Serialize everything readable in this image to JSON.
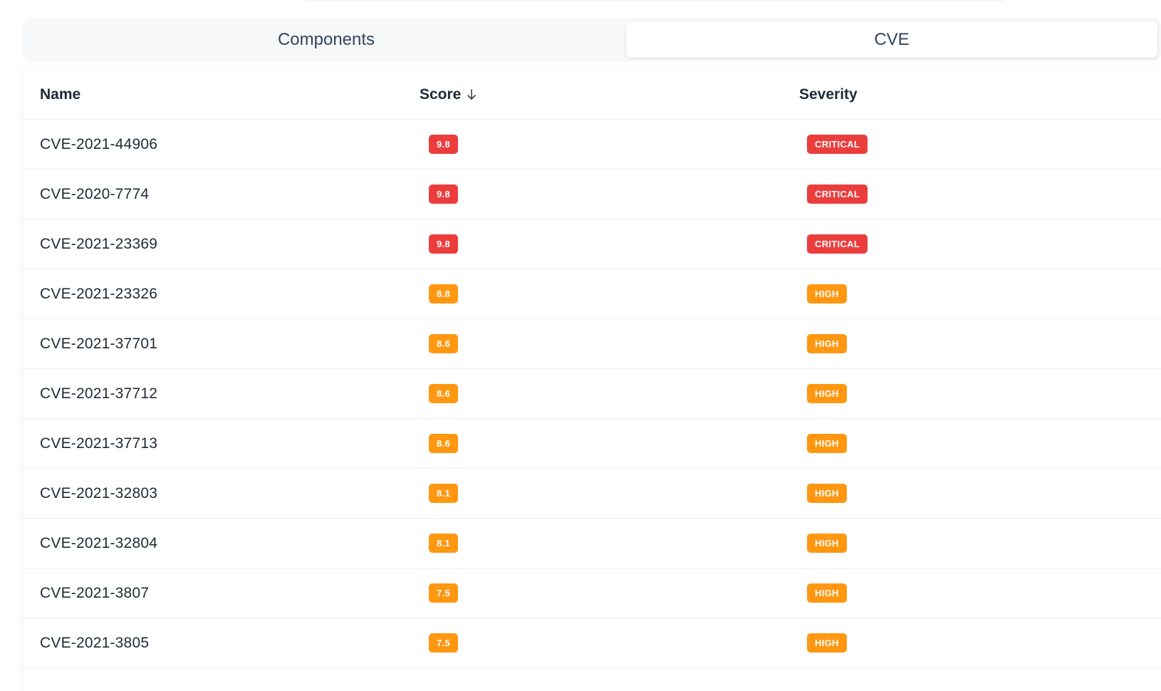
{
  "tabs": [
    {
      "label": "Components",
      "active": false
    },
    {
      "label": "CVE",
      "active": true
    }
  ],
  "table": {
    "headers": {
      "name": "Name",
      "score": "Score",
      "severity": "Severity"
    },
    "sort_icon": "arrow-down-icon",
    "rows": [
      {
        "name": "CVE-2021-44906",
        "score": "9.8",
        "severity": "CRITICAL"
      },
      {
        "name": "CVE-2020-7774",
        "score": "9.8",
        "severity": "CRITICAL"
      },
      {
        "name": "CVE-2021-23369",
        "score": "9.8",
        "severity": "CRITICAL"
      },
      {
        "name": "CVE-2021-23326",
        "score": "8.8",
        "severity": "HIGH"
      },
      {
        "name": "CVE-2021-37701",
        "score": "8.6",
        "severity": "HIGH"
      },
      {
        "name": "CVE-2021-37712",
        "score": "8.6",
        "severity": "HIGH"
      },
      {
        "name": "CVE-2021-37713",
        "score": "8.6",
        "severity": "HIGH"
      },
      {
        "name": "CVE-2021-32803",
        "score": "8.1",
        "severity": "HIGH"
      },
      {
        "name": "CVE-2021-32804",
        "score": "8.1",
        "severity": "HIGH"
      },
      {
        "name": "CVE-2021-3807",
        "score": "7.5",
        "severity": "HIGH"
      },
      {
        "name": "CVE-2021-3805",
        "score": "7.5",
        "severity": "HIGH"
      }
    ]
  },
  "colors": {
    "critical": "#ec3d3d",
    "high": "#ff9711"
  }
}
